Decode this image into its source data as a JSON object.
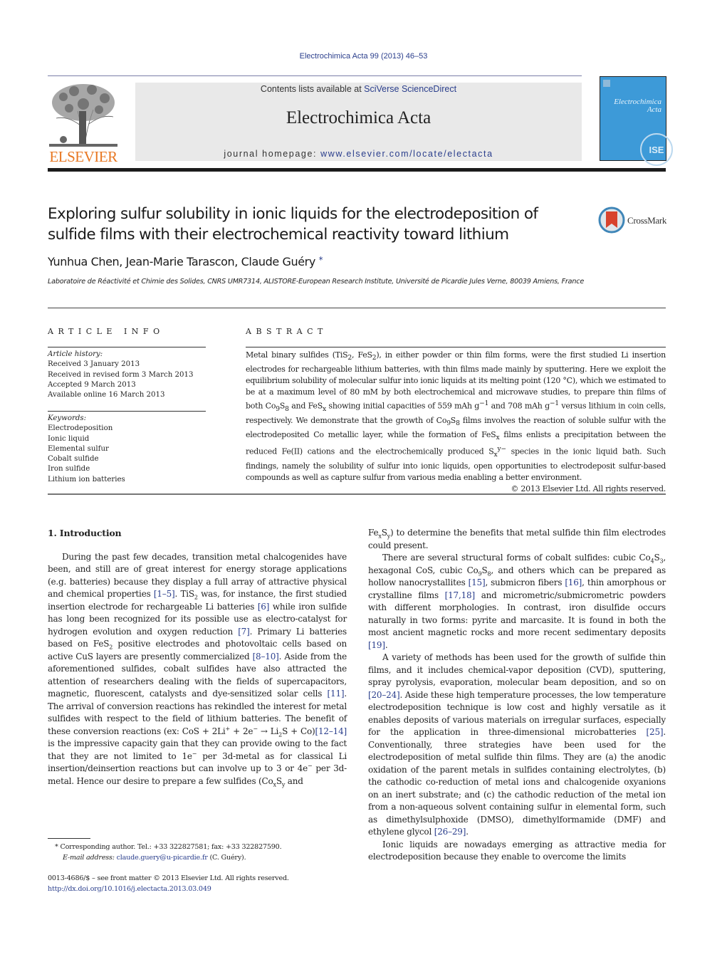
{
  "header": {
    "journal_ref": "Electrochimica Acta 99 (2013) 46–53",
    "contents_prefix": "Contents lists available at ",
    "contents_link": "SciVerse ScienceDirect",
    "journal_title": "Electrochimica Acta",
    "homepage_prefix": "journal homepage: ",
    "homepage_link": "www.elsevier.com/locate/electacta",
    "publisher_logo_text": "ELSEVIER",
    "cover_title_line1": "Electrochimica",
    "cover_title_line2": "Acta",
    "cover_badge": "ISE",
    "colors": {
      "link": "#2a3e8c",
      "elsevier": "#e87722",
      "cover": "#3d9ad8",
      "banner": "#e9e9e9"
    }
  },
  "article": {
    "title": "Exploring sulfur solubility in ionic liquids for the electrodeposition of sulfide films with their electrochemical reactivity toward lithium",
    "crossmark_label": "CrossMark",
    "authors": "Yunhua Chen, Jean-Marie Tarascon, Claude Guéry",
    "corresponding_mark": "*",
    "affiliation": "Laboratoire de Réactivité et Chimie des Solides, CNRS UMR7314, ALISTORE-European Research Institute, Université de Picardie Jules Verne, 80039 Amiens, France"
  },
  "article_info": {
    "heading": "ARTICLE INFO",
    "history_label": "Article history:",
    "history": [
      "Received 3 January 2013",
      "Received in revised form 3 March 2013",
      "Accepted 9 March 2013",
      "Available online 16 March 2013"
    ],
    "keywords_label": "Keywords:",
    "keywords": [
      "Electrodeposition",
      "Ionic liquid",
      "Elemental sulfur",
      "Cobalt sulfide",
      "Iron sulfide",
      "Lithium ion batteries"
    ]
  },
  "abstract": {
    "heading": "ABSTRACT",
    "parts": {
      "p1": "Metal binary sulfides (TiS",
      "p2": ", FeS",
      "p3": "), in either powder or thin film forms, were the first studied Li insertion electrodes for rechargeable lithium batteries, with thin films made mainly by sputtering. Here we exploit the equilibrium solubility of molecular sulfur into ionic liquids at its melting point (120 °C), which we estimated to be at a maximum level of 80 mM by both electrochemical and microwave studies, to prepare thin films of both Co",
      "p4": " and FeS",
      "p5": " showing initial capacities of 559 mAh g",
      "p6": " and 708 mAh g",
      "p7": " versus lithium in coin cells, respectively. We demonstrate that the growth of Co",
      "p8": " films involves the reaction of soluble sulfur with the electrodeposited Co metallic layer, while the formation of FeS",
      "p9": " films enlists a precipitation between the reduced Fe(II) cations and the electrochemically produced S",
      "p10": " species in the ionic liquid bath. Such findings, namely the solubility of sulfur into ionic liquids, open opportunities to electrodeposit sulfur-based compounds as well as capture sulfur from various media enabling a better environment.",
      "sub2": "2",
      "sub9": "9",
      "sub8": "8",
      "subx": "x",
      "sup_neg1": "−1",
      "sup_yneg": "y−"
    },
    "copyright": "© 2013 Elsevier Ltd. All rights reserved."
  },
  "body": {
    "section_title": "1.  Introduction",
    "left": {
      "a1": "During the past few decades, transition metal chalcogenides have been, and still are of great interest for energy storage applications (e.g. batteries) because they display a full array of attractive physical and chemical properties ",
      "r1": "[1–5]",
      "a2": ". TiS",
      "a3": " was, for instance, the first studied insertion electrode for rechargeable Li batteries ",
      "r2": "[6]",
      "a4": " while iron sulfide has long been recognized for its possible use as electro-catalyst for hydrogen evolution and oxygen reduction ",
      "r3": "[7]",
      "a5": ". Primary Li batteries based on FeS",
      "a6": " positive electrodes and photovoltaic cells based on active CuS layers are presently commercialized ",
      "r4": "[8–10]",
      "a7": ". Aside from the aforementioned sulfides, cobalt sulfides have also attracted the attention of researchers dealing with the fields of supercapacitors, magnetic, fluorescent, catalysts and dye-sensitized solar cells ",
      "r5": "[11]",
      "a8": ". The arrival of conversion reactions has rekindled the interest for metal sulfides with respect to the field of lithium batteries. The benefit of these conversion reactions (ex: CoS + 2Li",
      "a9": " + 2e",
      "a10": " → Li",
      "a11": "S + Co)",
      "r6": "[12–14]",
      "a12": " is the impressive capacity gain that they can provide owing to the fact that they are not limited to 1e",
      "a13": " per 3d-metal as for classical Li insertion/deinsertion reactions but can involve up to 3 or 4e",
      "a14": " per 3d-metal. Hence our desire to prepare a few sulfides (Co",
      "a15": "S",
      "a16": " and",
      "plus": "+",
      "minus": "−",
      "two": "2",
      "x": "x",
      "y": "y"
    },
    "right": {
      "b1": "Fe",
      "b2": "S",
      "b3": ") to determine the benefits that metal sulfide thin film electrodes could present.",
      "c1": "There are several structural forms of cobalt sulfides: cubic Co",
      "c2": "S",
      "c3": ", hexagonal CoS, cubic Co",
      "c4": "S",
      "c5": ", and others which can be prepared as hollow nanocrystallites ",
      "r15": "[15]",
      "c6": ", submicron fibers ",
      "r16": "[16]",
      "c7": ", thin amorphous or crystalline films ",
      "r17": "[17,18]",
      "c8": " and micrometric/submicrometric powders with different morphologies. In contrast, iron disulfide occurs naturally in two forms: pyrite and marcasite. It is found in both the most ancient magnetic rocks and more recent sedimentary deposits ",
      "r19": "[19]",
      "c9": ".",
      "d1": "A variety of methods has been used for the growth of sulfide thin films, and it includes chemical-vapor deposition (CVD), sputtering, spray pyrolysis, evaporation, molecular beam deposition, and so on ",
      "r20": "[20–24]",
      "d2": ". Aside these high temperature processes, the low temperature electrodeposition technique is low cost and highly versatile as it enables deposits of various materials on irregular surfaces, especially for the application in three-dimensional microbatteries ",
      "r25": "[25]",
      "d3": ". Conventionally, three strategies have been used for the electrodeposition of metal sulfide thin films. They are (a) the anodic oxidation of the parent metals in sulfides containing electrolytes, (b) the cathodic co-reduction of metal ions and chalcogenide oxyanions on an inert substrate; and (c) the cathodic reduction of the metal ion from a non-aqueous solvent containing sulfur in elemental form, such as dimethylsulphoxide (DMSO), dimethylformamide (DMF) and ethylene glycol ",
      "r26": "[26–29]",
      "d4": ".",
      "e1": "Ionic liquids are nowadays emerging as attractive media for electrodeposition because they enable to overcome the limits",
      "s4": "4",
      "s3": "3",
      "s9": "9",
      "s8": "8",
      "x": "x",
      "y": "y"
    }
  },
  "footnotes": {
    "corresponding": "* Corresponding author. Tel.: +33 322827581; fax: +33 322827590.",
    "email_label": "E-mail address: ",
    "email": "claude.guery@u-picardie.fr",
    "email_suffix": " (C. Guéry).",
    "issn": "0013-4686/$ – see front matter © 2013 Elsevier Ltd. All rights reserved.",
    "doi": "http://dx.doi.org/10.1016/j.electacta.2013.03.049"
  }
}
